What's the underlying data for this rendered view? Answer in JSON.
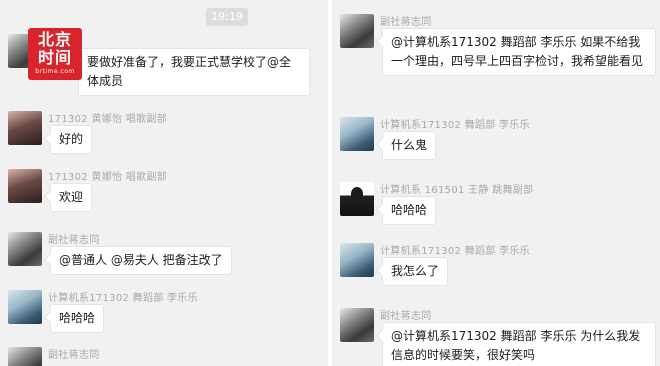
{
  "left": {
    "timestamp": "19:19",
    "messages": [
      {
        "sender": "",
        "text": "要做好准备了，我要正式慧学校了@全体成员"
      },
      {
        "sender": "171302 黄娜怡 唱歌副部",
        "text": "好的"
      },
      {
        "sender": "171302 黄娜怡 唱歌副部",
        "text": "欢迎"
      },
      {
        "sender": "副社蒋志同",
        "text": "@普通人 @易夫人 把备注改了"
      },
      {
        "sender": "计算机系171302   舞蹈部   李乐乐",
        "text": "哈哈哈"
      },
      {
        "sender": "副社蒋志同",
        "text": ""
      }
    ]
  },
  "right": {
    "messages": [
      {
        "sender": "副社蒋志同",
        "text": "@计算机系171302   舞蹈部   李乐乐 如果不给我一个理由，四号早上四百字检讨，我希望能看见"
      },
      {
        "sender": "计算机系171302   舞蹈部   李乐乐",
        "text": "什么鬼"
      },
      {
        "sender": "计算机系 161501 王静 跳舞副部",
        "text": "哈哈哈"
      },
      {
        "sender": "计算机系171302   舞蹈部   李乐乐",
        "text": "我怎么了"
      },
      {
        "sender": "副社蒋志同",
        "text": "@计算机系171302   舞蹈部   李乐乐 为什么我发信息的时候要笑，很好笑吗"
      }
    ]
  },
  "watermark": {
    "line1": "北京",
    "line2": "时间",
    "line3": "brtime.com",
    "color": "#d9242b"
  }
}
